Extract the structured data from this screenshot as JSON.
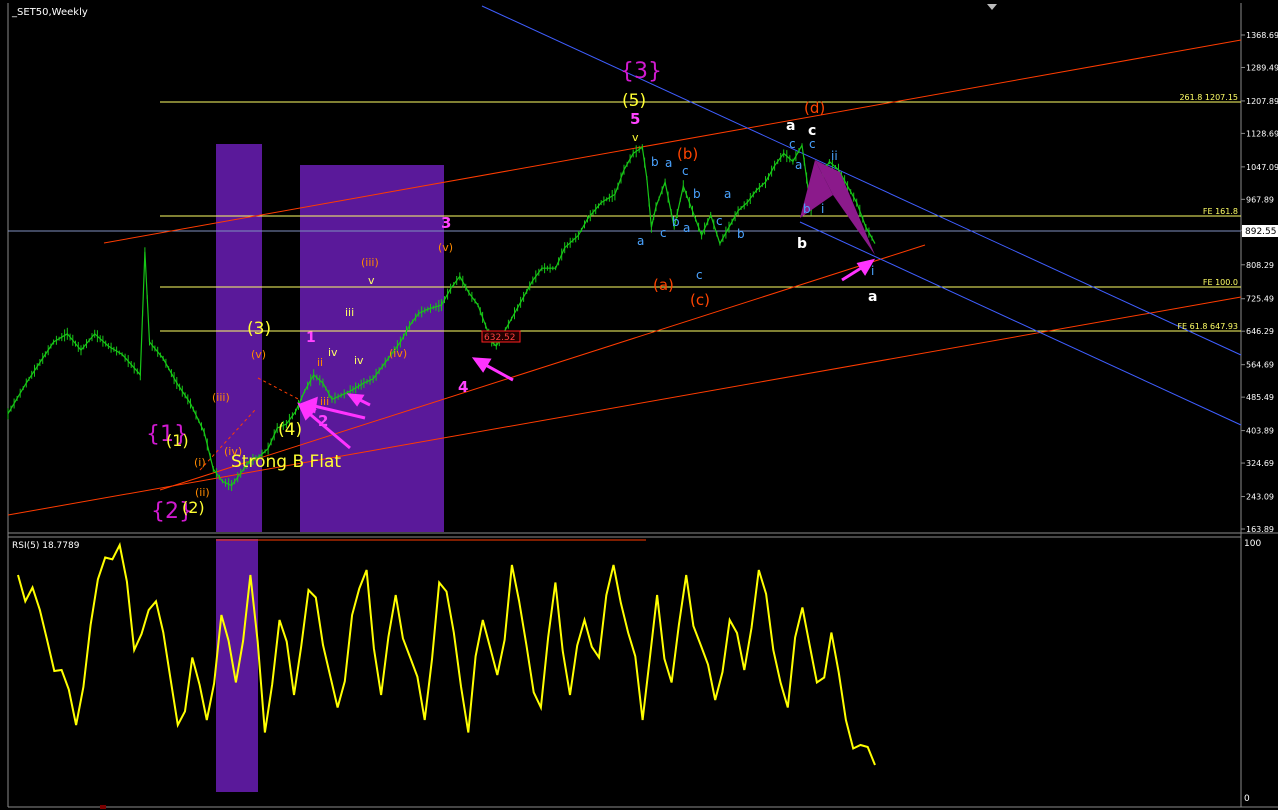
{
  "chart_data": [
    {
      "type": "candlestick",
      "symbol_label": "_SET50,Weekly",
      "y_ticks": [
        "1368.69",
        "1289.49",
        "1207.89",
        "1128.69",
        "1047.09",
        "967.89",
        "892.55",
        "808.29",
        "725.49",
        "646.29",
        "564.69",
        "485.49",
        "403.89",
        "324.69",
        "243.09",
        "163.89"
      ],
      "price_axis": [
        {
          "label": "1368.69",
          "value": 1368.69
        },
        {
          "label": "1289.49",
          "value": 1289.49
        },
        {
          "label": "1207.89",
          "value": 1207.89
        },
        {
          "label": "1128.69",
          "value": 1128.69
        },
        {
          "label": "1047.09",
          "value": 1047.09
        },
        {
          "label": "967.89",
          "value": 967.89
        },
        {
          "label": "892.55",
          "value": 892.55
        },
        {
          "label": "808.29",
          "value": 808.29
        },
        {
          "label": "725.49",
          "value": 725.49
        },
        {
          "label": "646.29",
          "value": 646.29
        },
        {
          "label": "564.69",
          "value": 564.69
        },
        {
          "label": "485.49",
          "value": 485.49
        },
        {
          "label": "403.89",
          "value": 403.89
        },
        {
          "label": "324.69",
          "value": 324.69
        },
        {
          "label": "243.09",
          "value": 243.09
        },
        {
          "label": "163.89",
          "value": 163.89
        }
      ],
      "current_price": "892.55",
      "price_path": [
        [
          0,
          445
        ],
        [
          4,
          520
        ],
        [
          7,
          570
        ],
        [
          10,
          620
        ],
        [
          13,
          640
        ],
        [
          16,
          600
        ],
        [
          19,
          640
        ],
        [
          22,
          610
        ],
        [
          25,
          590
        ],
        [
          29,
          540
        ],
        [
          30,
          840
        ],
        [
          31,
          620
        ],
        [
          34,
          580
        ],
        [
          37,
          520
        ],
        [
          40,
          470
        ],
        [
          43,
          400
        ],
        [
          45,
          310
        ],
        [
          47,
          280
        ],
        [
          49,
          270
        ],
        [
          51,
          300
        ],
        [
          53,
          330
        ],
        [
          55,
          340
        ],
        [
          57,
          360
        ],
        [
          59,
          410
        ],
        [
          61,
          420
        ],
        [
          63,
          450
        ],
        [
          65,
          500
        ],
        [
          67,
          540
        ],
        [
          69,
          520
        ],
        [
          71,
          480
        ],
        [
          73,
          490
        ],
        [
          75,
          500
        ],
        [
          78,
          520
        ],
        [
          80,
          530
        ],
        [
          82,
          560
        ],
        [
          84,
          590
        ],
        [
          86,
          620
        ],
        [
          88,
          660
        ],
        [
          90,
          690
        ],
        [
          92,
          700
        ],
        [
          95,
          710
        ],
        [
          97,
          750
        ],
        [
          99,
          780
        ],
        [
          101,
          740
        ],
        [
          103,
          710
        ],
        [
          104,
          680
        ],
        [
          106,
          620
        ],
        [
          107,
          610
        ],
        [
          109,
          650
        ],
        [
          111,
          690
        ],
        [
          113,
          730
        ],
        [
          115,
          770
        ],
        [
          117,
          800
        ],
        [
          120,
          800
        ],
        [
          122,
          850
        ],
        [
          125,
          880
        ],
        [
          127,
          920
        ],
        [
          130,
          960
        ],
        [
          133,
          980
        ],
        [
          135,
          1040
        ],
        [
          137,
          1080
        ],
        [
          139,
          1095
        ],
        [
          140,
          1020
        ],
        [
          141,
          900
        ],
        [
          142,
          950
        ],
        [
          144,
          1010
        ],
        [
          146,
          900
        ],
        [
          148,
          1000
        ],
        [
          150,
          940
        ],
        [
          152,
          880
        ],
        [
          154,
          930
        ],
        [
          156,
          860
        ],
        [
          158,
          900
        ],
        [
          160,
          940
        ],
        [
          162,
          960
        ],
        [
          164,
          990
        ],
        [
          166,
          1010
        ],
        [
          168,
          1050
        ],
        [
          170,
          1080
        ],
        [
          172,
          1060
        ],
        [
          174,
          1100
        ],
        [
          175,
          1020
        ],
        [
          176,
          940
        ],
        [
          178,
          1020
        ],
        [
          180,
          1060
        ],
        [
          182,
          1040
        ],
        [
          184,
          1000
        ],
        [
          186,
          960
        ],
        [
          188,
          900
        ],
        [
          190,
          860
        ]
      ],
      "rsi_series": [
        88,
        83,
        62,
        50,
        28,
        68,
        95,
        100,
        58,
        74,
        65,
        28,
        55,
        30,
        72,
        45,
        88,
        25,
        70,
        40,
        82,
        60,
        35,
        72,
        90,
        40,
        80,
        55,
        30,
        85,
        65,
        25,
        70,
        48,
        92,
        60,
        35,
        85,
        40,
        70,
        55,
        92,
        65,
        30,
        80,
        45,
        88,
        60,
        38,
        70,
        50,
        90,
        58,
        35,
        75,
        45,
        65,
        30,
        20,
        12
      ],
      "overlays": {
        "horizontal_levels": [
          {
            "label": "261.8 1207.15",
            "value": 1207.15,
            "color": "#ffff66"
          },
          {
            "label": "FE 161.8",
            "value": 954,
            "color": "#ffff66"
          },
          {
            "label": "FE 100.0",
            "value": 757,
            "color": "#ffff66"
          },
          {
            "label": "FE 61.8 647.93",
            "value": 647.93,
            "color": "#ffff66"
          }
        ],
        "price_tag": "632.52"
      },
      "wave_labels": [
        {
          "text": "{3}",
          "color": "#d01ad0"
        },
        {
          "text": "(5)",
          "color": "#ffff33"
        },
        {
          "text": "5",
          "color": "#ff44ff"
        },
        {
          "text": "v",
          "color": "#ffff33"
        },
        {
          "text": "{1}",
          "color": "#d01ad0"
        },
        {
          "text": "(1)",
          "color": "#ffff33"
        },
        {
          "text": "{2}",
          "color": "#d01ad0"
        },
        {
          "text": "(2)",
          "color": "#ffff33"
        },
        {
          "text": "(3)",
          "color": "#ffff33"
        },
        {
          "text": "(4)",
          "color": "#ffff33"
        },
        {
          "text": "(v)",
          "color": "#ff8a00"
        },
        {
          "text": "(iii)",
          "color": "#ff8a00"
        },
        {
          "text": "(iv)",
          "color": "#ff8a00"
        },
        {
          "text": "(i)",
          "color": "#ff8a00"
        },
        {
          "text": "(ii)",
          "color": "#ff8a00"
        },
        {
          "text": "1",
          "color": "#ff44ff"
        },
        {
          "text": "2",
          "color": "#ff44ff"
        },
        {
          "text": "3",
          "color": "#ff44ff"
        },
        {
          "text": "4",
          "color": "#ff44ff"
        },
        {
          "text": "(iii)",
          "color": "#ff8a00"
        },
        {
          "text": "(iv)",
          "color": "#ff8a00"
        },
        {
          "text": "(v)",
          "color": "#ff8a00"
        },
        {
          "text": "iii",
          "color": "#ffff66"
        },
        {
          "text": "iv",
          "color": "#ffff66"
        },
        {
          "text": "v",
          "color": "#ffff66"
        },
        {
          "text": "(a)",
          "color": "#ff4400"
        },
        {
          "text": "(b)",
          "color": "#ff4400"
        },
        {
          "text": "(c)",
          "color": "#ff4400"
        },
        {
          "text": "(d)",
          "color": "#ff4400"
        },
        {
          "text": "a",
          "color": "#ffffff"
        },
        {
          "text": "c",
          "color": "#ffffff"
        },
        {
          "text": "b",
          "color": "#ffffff"
        },
        {
          "text": "a",
          "color": "#ffffff"
        },
        {
          "text": "b",
          "color": "#4aa3ff"
        },
        {
          "text": "a",
          "color": "#4aa3ff"
        },
        {
          "text": "c",
          "color": "#4aa3ff"
        },
        {
          "text": "a",
          "color": "#4aa3ff"
        },
        {
          "text": "b",
          "color": "#4aa3ff"
        },
        {
          "text": "c",
          "color": "#4aa3ff"
        },
        {
          "text": "c",
          "color": "#4aa3ff"
        },
        {
          "text": "a",
          "color": "#4aa3ff"
        },
        {
          "text": "b",
          "color": "#4aa3ff"
        },
        {
          "text": "c",
          "color": "#4aa3ff"
        },
        {
          "text": "a",
          "color": "#4aa3ff"
        },
        {
          "text": "b",
          "color": "#4aa3ff"
        },
        {
          "text": "b",
          "color": "#4aa3ff"
        },
        {
          "text": "a",
          "color": "#4aa3ff"
        },
        {
          "text": "c",
          "color": "#4aa3ff"
        },
        {
          "text": "c",
          "color": "#4aa3ff"
        },
        {
          "text": "i",
          "color": "#ff8a00"
        },
        {
          "text": "ii",
          "color": "#ff8a00"
        },
        {
          "text": "i",
          "color": "#ffff66"
        },
        {
          "text": "ii",
          "color": "#ffff66"
        },
        {
          "text": "iii",
          "color": "#ffff66"
        },
        {
          "text": "iv",
          "color": "#ffff66"
        }
      ],
      "annotation_text": "Strong B Flat"
    },
    {
      "type": "line",
      "title": "RSI(5) 18.7789",
      "y_ticks": [
        "100",
        "0"
      ],
      "ylim": [
        0,
        100
      ]
    }
  ],
  "colors": {
    "background": "#000000",
    "candles": "#17c617",
    "rsi_line": "#ffff00",
    "channel_red": "#ff3c00",
    "channel_blue": "#3f5eff",
    "fib_level": "#ffff66",
    "purple_zone": "#5a199a",
    "magenta": "#ff33ff"
  }
}
